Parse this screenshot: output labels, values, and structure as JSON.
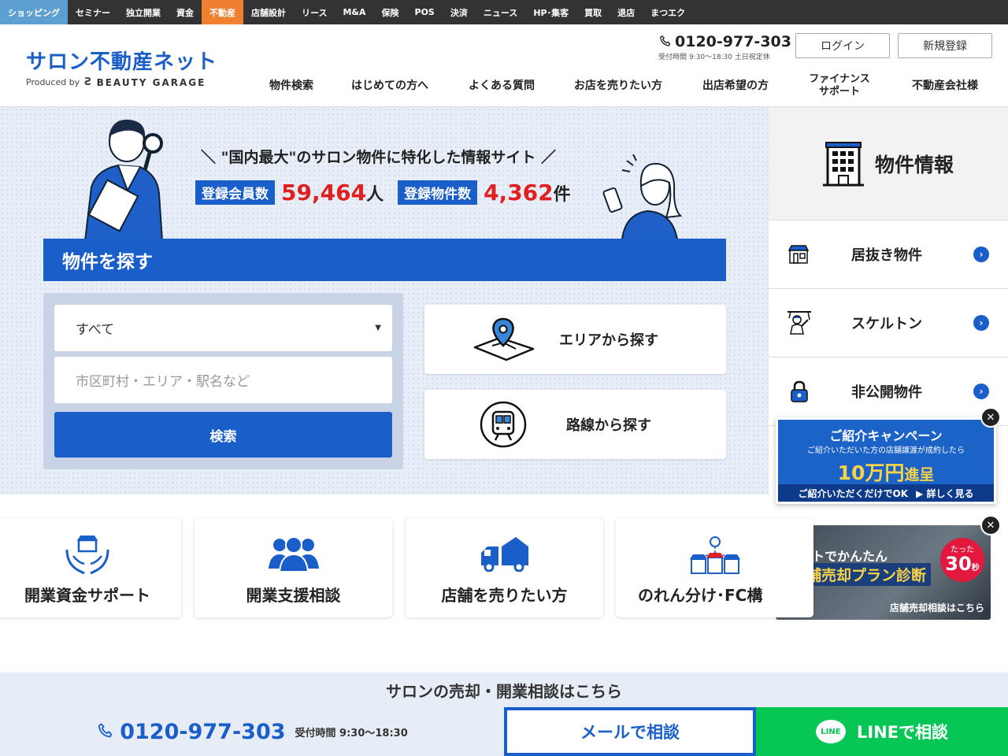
{
  "topbar": {
    "items": [
      "ショッピング",
      "セミナー",
      "独立開業",
      "資金",
      "不動産",
      "店舗設計",
      "リース",
      "M&A",
      "保険",
      "POS",
      "決済",
      "ニュース",
      "HP･集客",
      "買取",
      "退店",
      "まつエク"
    ],
    "active_index": 4,
    "colors": {
      "bar": "#333333",
      "first": "#5d9fd0",
      "active": "#f08030"
    }
  },
  "header": {
    "logo_title": "サロン不動産ネット",
    "logo_produced": "Produced by",
    "logo_brand": "BEAUTY GARAGE",
    "phone": "0120-977-303",
    "phone_hours": "受付時間 9:30〜18:30 土日祝定休",
    "login_label": "ログイン",
    "register_label": "新規登録",
    "nav": [
      "物件検索",
      "はじめての方へ",
      "よくある質問",
      "お店を売りたい方",
      "出店希望の方",
      "ファイナンス\nサポート",
      "不動産会社様"
    ]
  },
  "hero": {
    "tagline": "＼ \"国内最大\"のサロン物件に特化した情報サイト ／",
    "members_label": "登録会員数",
    "members_value": "59,464",
    "members_unit": "人",
    "properties_label": "登録物件数",
    "properties_value": "4,362",
    "properties_unit": "件"
  },
  "search": {
    "title": "物件を探す",
    "select_value": "すべて",
    "input_placeholder": "市区町村・エリア・駅名など",
    "button_label": "検索",
    "area_label": "エリアから探す",
    "route_label": "路線から探す"
  },
  "side": {
    "title": "物件情報",
    "items": [
      "居抜き物件",
      "スケルトン",
      "非公開物件"
    ]
  },
  "banner1": {
    "title": "ご紹介キャンペーン",
    "sub": "ご紹介いただいた方の店舗譲渡が成約したら",
    "amount": "10万円",
    "amount_suffix": "進呈",
    "foot_left": "ご紹介いただくだけでOK",
    "foot_right": "▶ 詳しく見る"
  },
  "banner2": {
    "line1": "ネットでかんたん",
    "line2": "店舗売却プラン診断",
    "badge_small": "たった",
    "badge_num": "30",
    "badge_unit": "秒",
    "foot": "店舗売却相談はこちら"
  },
  "services": [
    "開業資金サポート",
    "開業支援相談",
    "店舗を売りたい方",
    "のれん分け･FC構"
  ],
  "footer": {
    "band": "サロンの売却・開業相談はこちら",
    "phone": "0120-977-303",
    "hours": "受付時間 9:30～18:30",
    "mail": "メールで相談",
    "line": "LINEで相談",
    "line_icon": "LINE"
  },
  "colors": {
    "primary": "#1a5fc9",
    "accent_red": "#e02020",
    "line_green": "#06c755",
    "gold": "#f7d34a"
  }
}
